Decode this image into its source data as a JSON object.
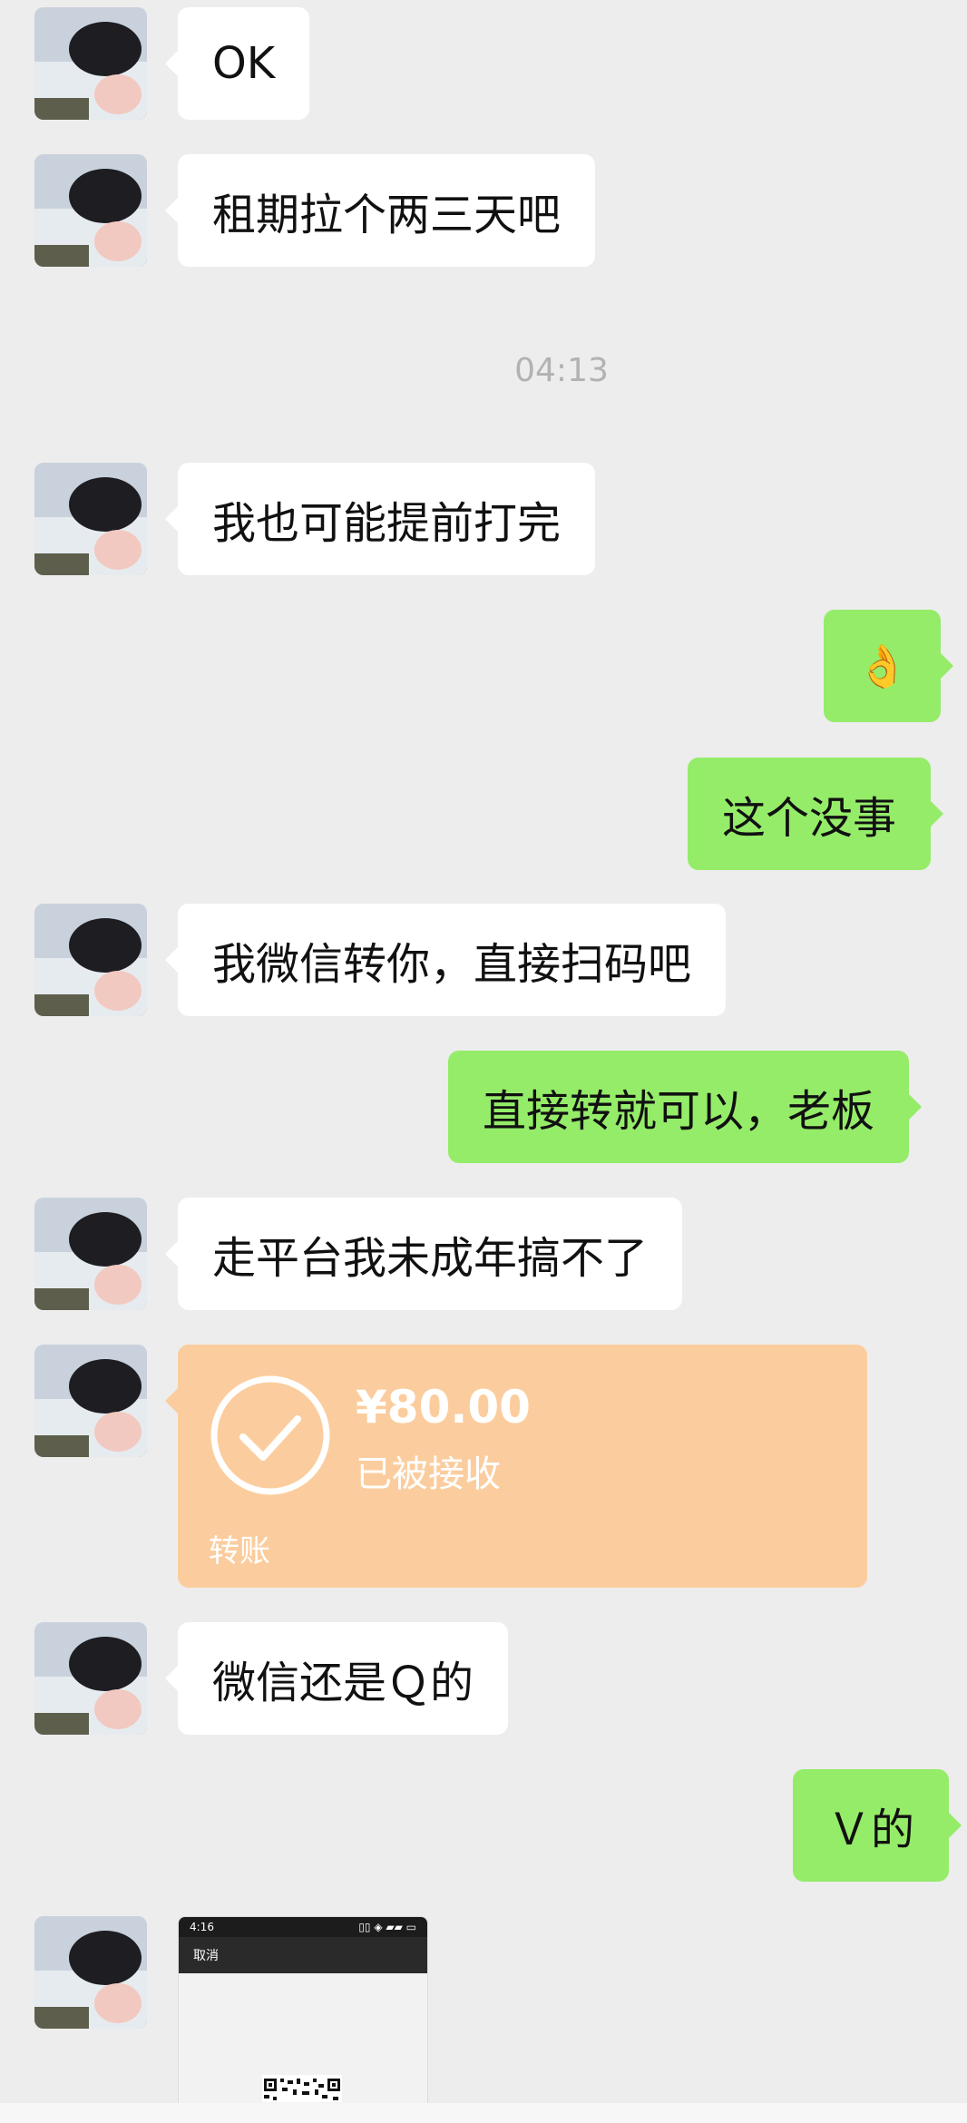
{
  "messages": {
    "m1": "OK",
    "m2": "租期拉个两三天吧",
    "time": "04:13",
    "m3": "我也可能提前打完",
    "m4": "👌",
    "m5": "这个没事",
    "m6": "我微信转你，直接扫码吧",
    "m7": "直接转就可以，老板",
    "m8": "走平台我未成年搞不了",
    "m9": "微信还是Ｑ的",
    "m10": "Ｖ的"
  },
  "transfer": {
    "amount": "¥80.00",
    "status": "已被接收",
    "label": "转账"
  },
  "image_message": {
    "status_time": "4:16",
    "status_icons": "▯▯ ◈ ▰▰ ▭",
    "cancel_label": "取消"
  },
  "colors": {
    "background": "#ededed",
    "incoming_bubble": "#ffffff",
    "outgoing_bubble": "#95ec69",
    "transfer_card": "#fbcd9e"
  },
  "icons": {
    "transfer": "check-circle-icon"
  }
}
